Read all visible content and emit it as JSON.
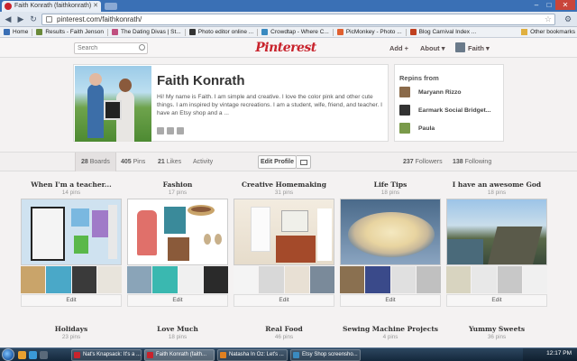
{
  "browser": {
    "tab_title": "Faith Konrath (faithkonrath)",
    "url": "pinterest.com/faithkonrath/",
    "other_bookmarks": "Other bookmarks",
    "bookmarks": [
      {
        "label": "Home",
        "color": "#3a6fb5"
      },
      {
        "label": "Results - Faith Jenson",
        "color": "#6a8a3a"
      },
      {
        "label": "The Dating Divas | St...",
        "color": "#c05080"
      },
      {
        "label": "Photo editor online ...",
        "color": "#333333"
      },
      {
        "label": "Crowdtap - Where C...",
        "color": "#3a8ac0"
      },
      {
        "label": "PicMonkey - Photo ...",
        "color": "#e06030"
      },
      {
        "label": "Blog Carnival Index ...",
        "color": "#c04020"
      }
    ]
  },
  "pinterest": {
    "search_placeholder": "Search",
    "logo": "Pinterest",
    "nav": {
      "add": "Add +",
      "about": "About ▾",
      "user": "Faith ▾"
    },
    "profile": {
      "name": "Faith Konrath",
      "bio": "Hi! My name is Faith. I am simple and creative. I love the color pink and other cute things. I am inspired by vintage recreations. I am a student, wife, friend, and teacher. I have an Etsy shop and a ..."
    },
    "repins": {
      "title": "Repins from",
      "items": [
        {
          "name": "Maryann Rizzo",
          "color": "#8a6a4a"
        },
        {
          "name": "Earmark Social Bridget...",
          "color": "#333333"
        },
        {
          "name": "Paula",
          "color": "#7a9a4a"
        }
      ]
    },
    "stats": {
      "boards": "28",
      "boards_label": "Boards",
      "pins": "405",
      "pins_label": "Pins",
      "likes": "21",
      "likes_label": "Likes",
      "activity": "Activity",
      "edit_profile": "Edit Profile",
      "followers": "237",
      "followers_label": "Followers",
      "following": "138",
      "following_label": "Following"
    },
    "boards": [
      {
        "title": "When I'm a teacher...",
        "count": "14 pins",
        "edit": "Edit"
      },
      {
        "title": "Fashion",
        "count": "17 pins",
        "edit": "Edit"
      },
      {
        "title": "Creative Homemaking",
        "count": "31 pins",
        "edit": "Edit"
      },
      {
        "title": "Life Tips",
        "count": "18 pins",
        "edit": "Edit"
      },
      {
        "title": "I have an awesome God",
        "count": "18 pins",
        "edit": "Edit"
      },
      {
        "title": "Holidays",
        "count": "23 pins"
      },
      {
        "title": "Love Much",
        "count": "18 pins"
      },
      {
        "title": "Real Food",
        "count": "46 pins"
      },
      {
        "title": "Sewing Machine Projects",
        "count": "4 pins"
      },
      {
        "title": "Yummy Sweets",
        "count": "36 pins"
      }
    ]
  },
  "taskbar": {
    "tasks": [
      {
        "label": "Nat's Knapsack: It's a ...",
        "color": "#c8232c"
      },
      {
        "label": "Faith Konrath (faith...",
        "color": "#c8232c"
      },
      {
        "label": "Natasha In Oz: Let's ...",
        "color": "#e08020"
      },
      {
        "label": "Etsy Shop screensho...",
        "color": "#3a8ac0"
      }
    ],
    "clock": "12:17 PM"
  }
}
